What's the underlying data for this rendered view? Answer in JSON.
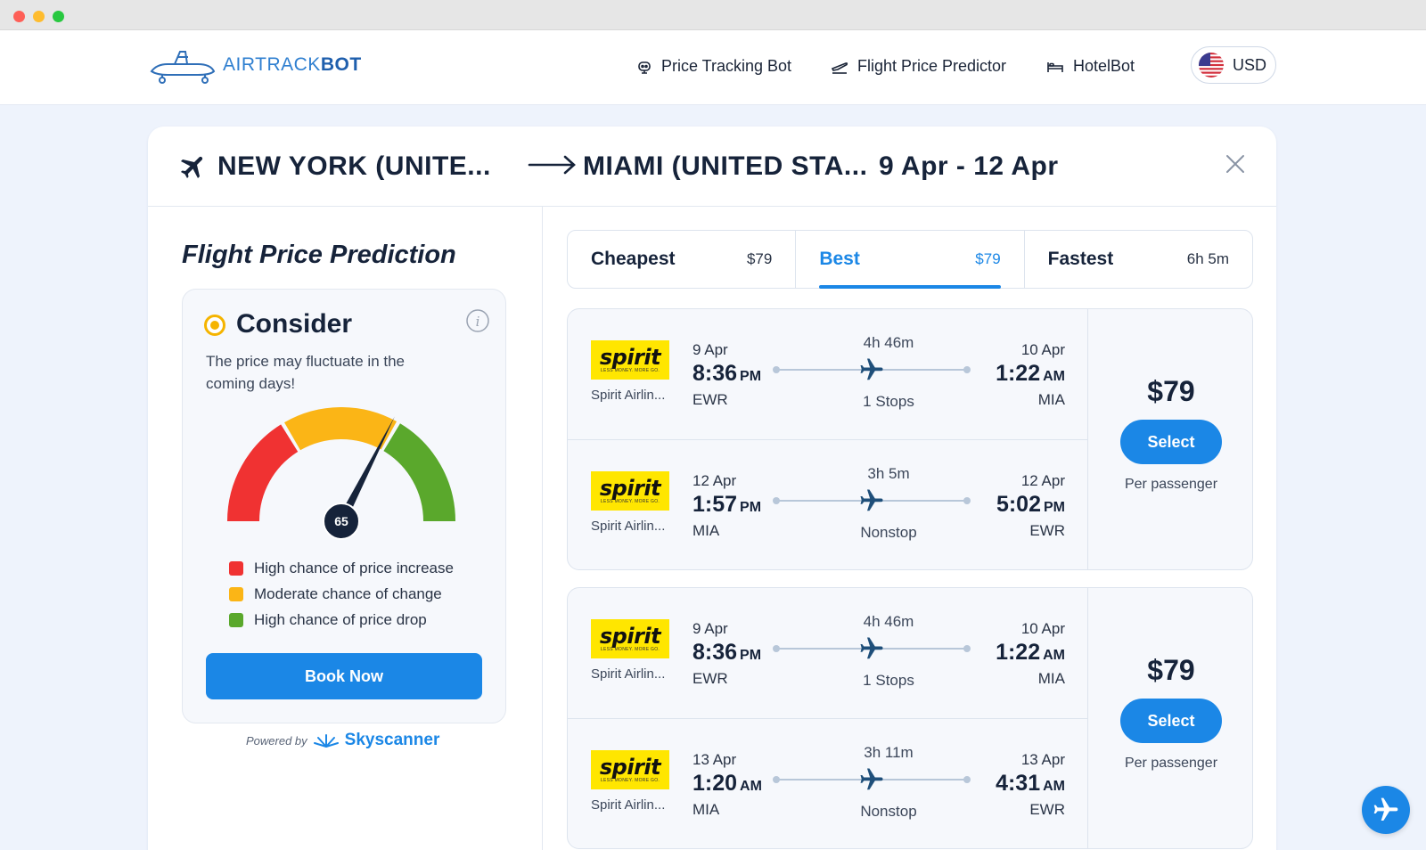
{
  "brand": {
    "name_light": "AIRTRACK",
    "name_bold": "BOT",
    "accent": "#1b87e6"
  },
  "nav": {
    "items": [
      {
        "label": "Price Tracking Bot",
        "icon": "robot-icon"
      },
      {
        "label": "Flight Price Predictor",
        "icon": "takeoff-icon"
      },
      {
        "label": "HotelBot",
        "icon": "bed-icon"
      }
    ],
    "currency": {
      "label": "USD",
      "icon": "us-flag-icon"
    }
  },
  "route": {
    "origin": "NEW YORK (UNITE...",
    "destination": "MIAMI (UNITED STA...",
    "dates": "9 Apr - 12 Apr"
  },
  "prediction": {
    "title": "Flight Price Prediction",
    "status": "Consider",
    "status_color": "#f5b400",
    "description": "The price may fluctuate in the coming days!",
    "gauge_value": "65",
    "gauge_score": 65,
    "gauge_colors": [
      "#f03232",
      "#fbb516",
      "#5aa82c"
    ],
    "legend": [
      {
        "label": "High chance of price increase",
        "color": "#f03232"
      },
      {
        "label": "Moderate chance of change",
        "color": "#fbb516"
      },
      {
        "label": "High chance of price drop",
        "color": "#5aa82c"
      }
    ],
    "book_label": "Book Now",
    "powered_by": "Powered by",
    "provider": "Skyscanner"
  },
  "tabs": [
    {
      "name": "Cheapest",
      "value": "$79",
      "active": false
    },
    {
      "name": "Best",
      "value": "$79",
      "active": true
    },
    {
      "name": "Fastest",
      "value": "6h 5m",
      "active": false
    }
  ],
  "results": [
    {
      "price": "$79",
      "select_label": "Select",
      "per": "Per passenger",
      "legs": [
        {
          "airline": "Spirit Airlin...",
          "logo": "spirit",
          "logo_tag": "LESS MONEY. MORE GO.",
          "dep_date": "9 Apr",
          "dep_time": "8:36",
          "dep_ampm": "PM",
          "dep_code": "EWR",
          "duration": "4h 46m",
          "stops": "1 Stops",
          "arr_date": "10 Apr",
          "arr_time": "1:22",
          "arr_ampm": "AM",
          "arr_code": "MIA"
        },
        {
          "airline": "Spirit Airlin...",
          "logo": "spirit",
          "logo_tag": "LESS MONEY. MORE GO.",
          "dep_date": "12 Apr",
          "dep_time": "1:57",
          "dep_ampm": "PM",
          "dep_code": "MIA",
          "duration": "3h 5m",
          "stops": "Nonstop",
          "arr_date": "12 Apr",
          "arr_time": "5:02",
          "arr_ampm": "PM",
          "arr_code": "EWR"
        }
      ]
    },
    {
      "price": "$79",
      "select_label": "Select",
      "per": "Per passenger",
      "legs": [
        {
          "airline": "Spirit Airlin...",
          "logo": "spirit",
          "logo_tag": "LESS MONEY. MORE GO.",
          "dep_date": "9 Apr",
          "dep_time": "8:36",
          "dep_ampm": "PM",
          "dep_code": "EWR",
          "duration": "4h 46m",
          "stops": "1 Stops",
          "arr_date": "10 Apr",
          "arr_time": "1:22",
          "arr_ampm": "AM",
          "arr_code": "MIA"
        },
        {
          "airline": "Spirit Airlin...",
          "logo": "spirit",
          "logo_tag": "LESS MONEY. MORE GO.",
          "dep_date": "13 Apr",
          "dep_time": "1:20",
          "dep_ampm": "AM",
          "dep_code": "MIA",
          "duration": "3h 11m",
          "stops": "Nonstop",
          "arr_date": "13 Apr",
          "arr_time": "4:31",
          "arr_ampm": "AM",
          "arr_code": "EWR"
        }
      ]
    }
  ]
}
